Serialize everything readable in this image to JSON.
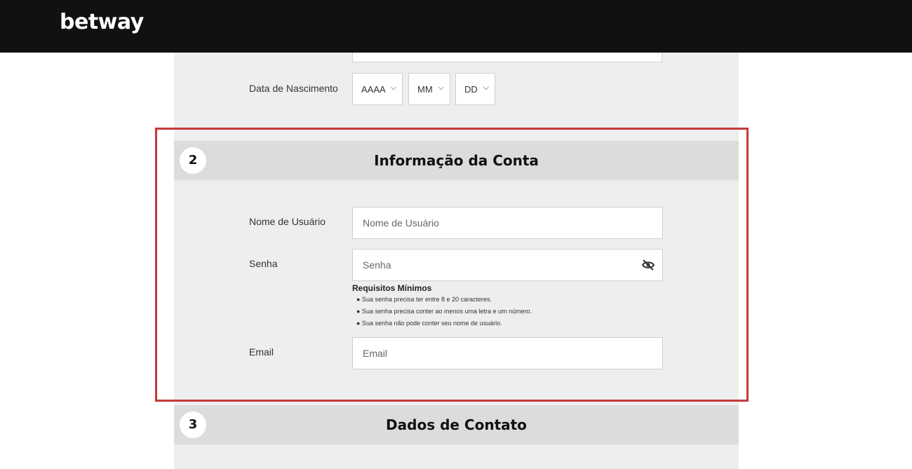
{
  "header": {
    "logo": "betway"
  },
  "section1": {
    "dob_label": "Data de Nascimento",
    "year_value": "AAAA",
    "month_value": "MM",
    "day_value": "DD"
  },
  "section2": {
    "number": "2",
    "title": "Informação da Conta",
    "username_label": "Nome de Usuário",
    "username_placeholder": "Nome de Usuário",
    "password_label": "Senha",
    "password_placeholder": "Senha",
    "requirements_title": "Requisitos Mínimos",
    "requirements": [
      "● Sua senha precisa ter entre 8 e 20 caracteres.",
      "● Sua senha precisa conter ao menos uma letra e um número.",
      "● Sua senha não pode conter seu nome de usuário."
    ],
    "email_label": "Email",
    "email_placeholder": "Email"
  },
  "section3": {
    "number": "3",
    "title": "Dados de Contato"
  },
  "colors": {
    "header_bg": "#111111",
    "panel_bg": "#eeeeee",
    "section_header_bg": "#dcdcdc",
    "highlight_border": "#c43a3a"
  },
  "icons": {
    "caret": "chevron-down-icon",
    "password_toggle": "eye-slash-icon"
  }
}
